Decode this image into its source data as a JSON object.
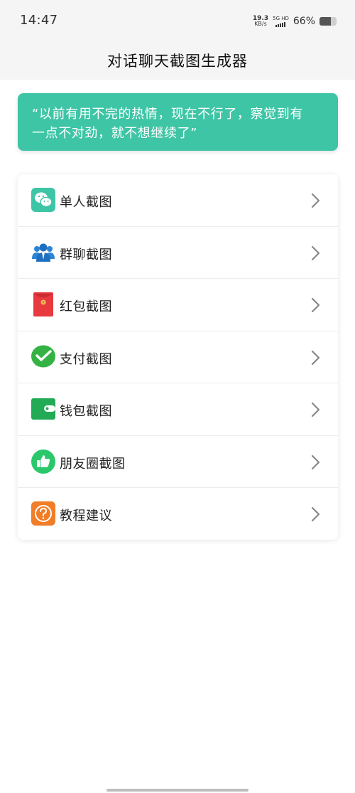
{
  "status_bar": {
    "time": "14:47",
    "net_speed_value": "19.3",
    "net_speed_unit": "KB/s",
    "network": "5G HD",
    "battery_percent": "66%",
    "battery_level": 0.66
  },
  "header": {
    "title": "对话聊天截图生成器"
  },
  "quote": {
    "line1": "“以前有用不完的热情，现在不行了，察觉到有",
    "line2": "一点不对劲，就不想继续了”"
  },
  "menu": {
    "items": [
      {
        "label": "单人截图",
        "icon": "wechat-chat-icon",
        "color": "#3ec5a6"
      },
      {
        "label": "群聊截图",
        "icon": "group-users-icon",
        "color": "#2b84d6"
      },
      {
        "label": "红包截图",
        "icon": "red-envelope-icon",
        "color": "#e8393e"
      },
      {
        "label": "支付截图",
        "icon": "payment-check-icon",
        "color": "#34b344"
      },
      {
        "label": "钱包截图",
        "icon": "wallet-icon",
        "color": "#22aa55"
      },
      {
        "label": "朋友圈截图",
        "icon": "thumbs-up-icon",
        "color": "#2ac86a"
      },
      {
        "label": "教程建议",
        "icon": "help-question-icon",
        "color": "#f07d27"
      }
    ]
  },
  "colors": {
    "accent": "#3ec5a6",
    "header_bg": "#f5f5f5",
    "chevron": "#888888"
  }
}
